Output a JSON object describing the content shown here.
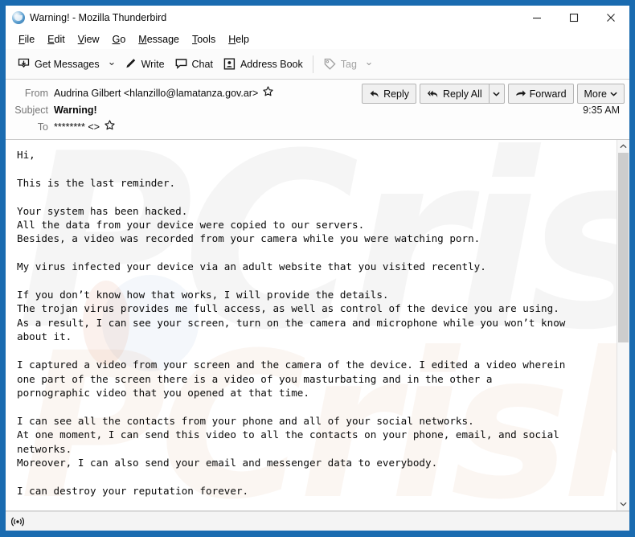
{
  "window": {
    "title": "Warning! - Mozilla Thunderbird",
    "app_icon": "thunderbird-icon",
    "controls": {
      "minimize": "minimize-icon",
      "maximize": "maximize-icon",
      "close": "close-icon"
    },
    "border_color": "#1a6bb0"
  },
  "menubar": {
    "items": [
      {
        "label": "File",
        "accel": "F"
      },
      {
        "label": "Edit",
        "accel": "E"
      },
      {
        "label": "View",
        "accel": "V"
      },
      {
        "label": "Go",
        "accel": "G"
      },
      {
        "label": "Message",
        "accel": "M"
      },
      {
        "label": "Tools",
        "accel": "T"
      },
      {
        "label": "Help",
        "accel": "H"
      }
    ]
  },
  "toolbar": {
    "get_messages": "Get Messages",
    "write": "Write",
    "chat": "Chat",
    "address_book": "Address Book",
    "tag": "Tag",
    "hamburger": "app-menu-button"
  },
  "message_header": {
    "from_label": "From",
    "from_value": "Audrina Gilbert <hlanzillo@lamatanza.gov.ar>",
    "subject_label": "Subject",
    "subject_value": "Warning!",
    "to_label": "To",
    "to_value": "******** <>",
    "time": "9:35 AM",
    "buttons": {
      "reply": "Reply",
      "reply_all": "Reply All",
      "forward": "Forward",
      "more": "More"
    }
  },
  "message_body": {
    "watermark": "PCrisk.com",
    "text": "Hi,\n\nThis is the last reminder.\n\nYour system has been hacked.\nAll the data from your device were copied to our servers.\nBesides, a video was recorded from your camera while you were watching porn.\n\nMy virus infected your device via an adult website that you visited recently.\n\nIf you don’t know how that works, I will provide the details.\nThe trojan virus provides me full access, as well as control of the device you are using.\nAs a result, I can see your screen, turn on the camera and microphone while you won’t know\nabout it.\n\nI captured a video from your screen and the camera of the device. I edited a video wherein\none part of the screen there is a video of you masturbating and in the other a\npornographic video that you opened at that time.\n\nI can see all the contacts from your phone and all of your social networks.\nAt one moment, I can send this video to all the contacts on your phone, email, and social\nnetworks.\nMoreover, I can also send your email and messenger data to everybody.\n\nI can destroy your reputation forever."
  },
  "statusbar": {
    "icon": "network-activity-icon"
  }
}
